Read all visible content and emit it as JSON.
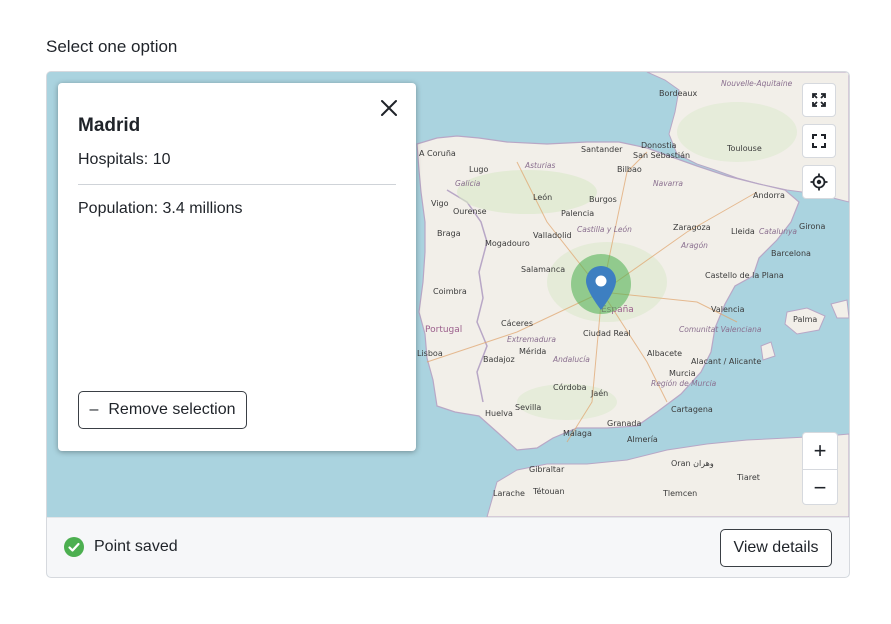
{
  "prompt": "Select one option",
  "colors": {
    "accent": "#3d7fc1",
    "success": "#4caf50",
    "water": "#aad3df",
    "land": "#f2efe9"
  },
  "map": {
    "icons": [
      "expand-icon",
      "fullscreen-icon",
      "locate-icon",
      "map-pin-icon"
    ],
    "labels": {
      "bordeaux": "Bordeaux",
      "toulouse": "Toulouse",
      "andorra": "Andorra",
      "girona": "Girona",
      "barcelona": "Barcelona",
      "lleida": "Lleida",
      "zaragoza": "Zaragoza",
      "acoruna": "A Coruña",
      "lugo": "Lugo",
      "santander": "Santander",
      "sansebastian": "San Sebastián",
      "donostia": "Donostia",
      "bilbao": "Bilbao",
      "burgos": "Burgos",
      "leon": "León",
      "palencia": "Palencia",
      "ourense": "Ourense",
      "vigo": "Vigo",
      "braga": "Braga",
      "valladolid": "Valladolid",
      "mogadouro": "Mogadouro",
      "salamanca": "Salamanca",
      "coimbra": "Coimbra",
      "portugal": "Portugal",
      "caceres": "Cáceres",
      "lisboa": "Lisboa",
      "badajoz": "Badajoz",
      "merida": "Mérida",
      "ciudadreal": "Ciudad Real",
      "espana": "España",
      "castello": "Castello de la Plana",
      "valencia": "Valencia",
      "palma": "Palma",
      "albacete": "Albacete",
      "alacant": "Alacant / Alicante",
      "cordoba": "Córdoba",
      "jaen": "Jaén",
      "sevilla": "Sevilla",
      "huelva": "Huelva",
      "granada": "Granada",
      "murcia": "Murcia",
      "cartagena": "Cartagena",
      "almeria": "Almería",
      "malaga": "Málaga",
      "gibraltar": "Gibraltar",
      "oran": "Oran وهران",
      "tlemcen": "Tlemcen",
      "tiaret": "Tiaret",
      "larache": "Larache",
      "tetouan": "Tétouan",
      "aquitaine": "Nouvelle-Aquitaine",
      "navarra": "Navarra",
      "catalunya": "Catalunya",
      "aragon": "Aragón",
      "castilla": "Castilla y León",
      "galicia": "Galicia",
      "asturias": "Asturias",
      "extremadura": "Extremadura",
      "comunitat": "Comunitat Valenciana",
      "murciareg": "Región de Murcia",
      "andalucia": "Andalucía"
    }
  },
  "popup": {
    "title": "Madrid",
    "hospitals": "Hospitals: 10",
    "population": "Population: 3.4 millions",
    "remove_label": "Remove selection"
  },
  "zoom": {
    "in": "+",
    "out": "−"
  },
  "footer": {
    "status": "Point saved",
    "details_label": "View details"
  }
}
